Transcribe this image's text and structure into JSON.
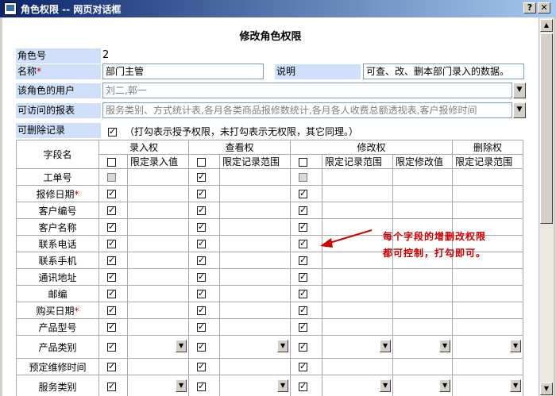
{
  "window": {
    "title": "角色权限 -- 网页对话框",
    "help_label": "?",
    "close_label": "✕"
  },
  "page_title": "修改角色权限",
  "form": {
    "role_id_label": "角色号",
    "role_id_value": "2",
    "name_label": "名称",
    "name_required": "*",
    "name_value": "部门主管",
    "desc_label": "说明",
    "desc_value": "可查、改、删本部门录入的数据。",
    "users_label": "该角色的用户",
    "users_value": "刘二,郭一",
    "reports_label": "可访问的报表",
    "reports_value": "服务类别、方式统计表,各月各类商品报修数统计,各月各人收费总额透视表,客户报修时间",
    "deletable_label": "可删除记录",
    "deletable_note": "（打勾表示授予权限，未打勾表示无权限，其它同理。）"
  },
  "table": {
    "field_name_header": "字段名",
    "group_entry": "录入权",
    "group_view": "查看权",
    "group_edit": "修改权",
    "group_delete": "删除权",
    "sub_entry_limit": "限定录入值",
    "sub_view_range": "限定记录范围",
    "sub_edit_range": "限定记录范围",
    "sub_edit_value": "限定修改值",
    "sub_delete_range": "限定记录范围",
    "rows": [
      {
        "name": "工单号",
        "req": ""
      },
      {
        "name": "报修日期",
        "req": "*"
      },
      {
        "name": "客户编号",
        "req": ""
      },
      {
        "name": "客户名称",
        "req": ""
      },
      {
        "name": "联系电话",
        "req": ""
      },
      {
        "name": "联系手机",
        "req": ""
      },
      {
        "name": "通讯地址",
        "req": ""
      },
      {
        "name": "邮编",
        "req": ""
      },
      {
        "name": "购买日期",
        "req": "*"
      },
      {
        "name": "产品型号",
        "req": ""
      },
      {
        "name": "产品类别",
        "req": ""
      },
      {
        "name": "预定维修时间",
        "req": ""
      },
      {
        "name": "服务类别",
        "req": ""
      }
    ]
  },
  "annotation": {
    "line1": "每个字段的增删改权限",
    "line2": "都可控制，打勾即可。"
  },
  "colors": {
    "title_bar": "#0a246a",
    "label_bg": "#cfe0f8",
    "required": "#d00000",
    "annotation": "#d00000"
  }
}
